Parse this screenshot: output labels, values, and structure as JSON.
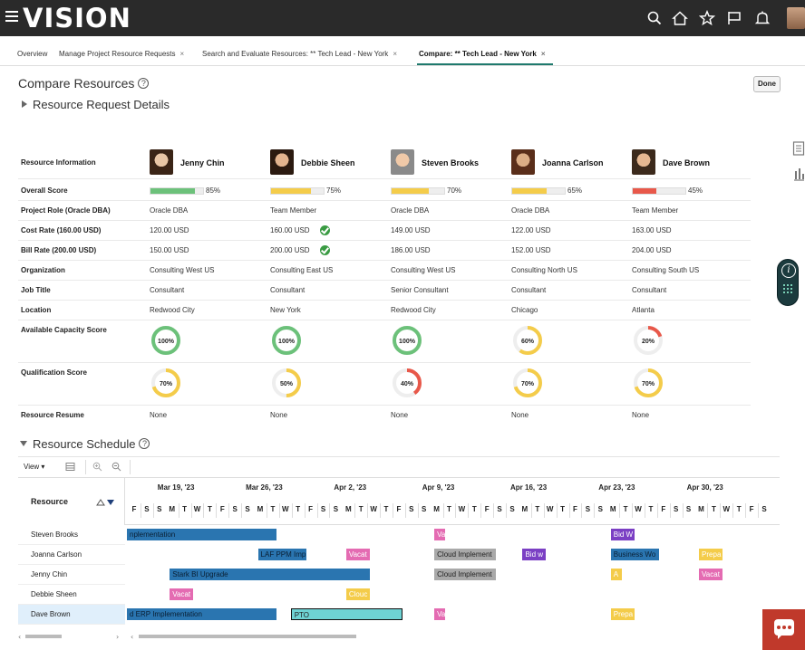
{
  "app": {
    "brand": "VISION"
  },
  "tabs": [
    {
      "label": "Overview",
      "closable": false
    },
    {
      "label": "Manage Project Resource Requests",
      "closable": true
    },
    {
      "label": "Search and Evaluate Resources: ** Tech Lead - New York",
      "closable": true
    },
    {
      "label": "Compare: ** Tech Lead - New York",
      "closable": true,
      "active": true
    }
  ],
  "tab_close_glyph": "×",
  "page": {
    "title": "Compare Resources",
    "done_label": "Done",
    "details_label": "Resource Request Details"
  },
  "compare": {
    "header_label": "Resource Information",
    "row_labels": {
      "overall": "Overall Score",
      "role": "Project Role (Oracle DBA)",
      "cost": "Cost Rate (160.00 USD)",
      "bill": "Bill Rate (200.00 USD)",
      "org": "Organization",
      "job": "Job Title",
      "location": "Location",
      "capacity": "Available Capacity Score",
      "qualification": "Qualification Score",
      "resume": "Resource Resume"
    },
    "people": [
      {
        "name": "Jenny Chin",
        "overall": 85,
        "overall_label": "85%",
        "role": "Oracle DBA",
        "cost": "120.00 USD",
        "cost_ok": false,
        "bill": "150.00 USD",
        "bill_ok": false,
        "org": "Consulting West US",
        "job": "Consultant",
        "location": "Redwood City",
        "capacity": 100,
        "capacity_label": "100%",
        "qualification": 70,
        "qualification_label": "70%",
        "resume": "None"
      },
      {
        "name": "Debbie Sheen",
        "overall": 75,
        "overall_label": "75%",
        "role": "Team Member",
        "cost": "160.00 USD",
        "cost_ok": true,
        "bill": "200.00 USD",
        "bill_ok": true,
        "org": "Consulting East US",
        "job": "Consultant",
        "location": "New York",
        "capacity": 100,
        "capacity_label": "100%",
        "qualification": 50,
        "qualification_label": "50%",
        "resume": "None"
      },
      {
        "name": "Steven Brooks",
        "overall": 70,
        "overall_label": "70%",
        "role": "Oracle DBA",
        "cost": "149.00 USD",
        "cost_ok": false,
        "bill": "186.00 USD",
        "bill_ok": false,
        "org": "Consulting West US",
        "job": "Senior Consultant",
        "location": "Redwood City",
        "capacity": 100,
        "capacity_label": "100%",
        "qualification": 40,
        "qualification_label": "40%",
        "resume": "None"
      },
      {
        "name": "Joanna Carlson",
        "overall": 65,
        "overall_label": "65%",
        "role": "Oracle DBA",
        "cost": "122.00 USD",
        "cost_ok": false,
        "bill": "152.00 USD",
        "bill_ok": false,
        "org": "Consulting North US",
        "job": "Consultant",
        "location": "Chicago",
        "capacity": 60,
        "capacity_label": "60%",
        "qualification": 70,
        "qualification_label": "70%",
        "resume": "None"
      },
      {
        "name": "Dave Brown",
        "overall": 45,
        "overall_label": "45%",
        "role": "Team Member",
        "cost": "163.00 USD",
        "cost_ok": false,
        "bill": "204.00 USD",
        "bill_ok": false,
        "org": "Consulting South US",
        "job": "Consultant",
        "location": "Atlanta",
        "capacity": 20,
        "capacity_label": "20%",
        "qualification": 70,
        "qualification_label": "70%",
        "resume": "None"
      }
    ]
  },
  "colors": {
    "green": "#6cc17a",
    "yellow": "#f4cc4a",
    "red": "#e8584a",
    "track": "#eeeeee",
    "accent": "#1f7a6d"
  },
  "schedule": {
    "title": "Resource Schedule",
    "view_label": "View",
    "resource_header": "Resource",
    "weeks": [
      "Mar 19, '23",
      "Mar 26, '23",
      "Apr 2, '23",
      "Apr 9, '23",
      "Apr 16, '23",
      "Apr 23, '23",
      "Apr 30, '23"
    ],
    "days": [
      "F",
      "S",
      "S",
      "M",
      "T",
      "W",
      "T",
      "F",
      "S",
      "S",
      "M",
      "T",
      "W",
      "T",
      "F",
      "S",
      "S",
      "M",
      "T",
      "W",
      "T",
      "F",
      "S",
      "S",
      "M",
      "T",
      "W",
      "T",
      "F",
      "S",
      "S",
      "M",
      "T",
      "W",
      "T",
      "F",
      "S",
      "S",
      "M",
      "T",
      "W",
      "T",
      "F",
      "S",
      "S",
      "M",
      "T",
      "W",
      "T",
      "F",
      "S"
    ],
    "resources": [
      "Steven Brooks",
      "Joanna Carlson",
      "Jenny Chin",
      "Debbie Sheen",
      "Dave Brown"
    ],
    "selected_resource": "Dave Brown",
    "bars": [
      {
        "row": 0,
        "start": 0,
        "days": 12,
        "color": "blue",
        "label": "nplementation"
      },
      {
        "row": 0,
        "start": 24.4,
        "days": 1,
        "color": "pink",
        "label": "Va"
      },
      {
        "row": 0,
        "start": 38.4,
        "days": 2,
        "color": "purple",
        "label": "Bid W"
      },
      {
        "row": 1,
        "start": 10.4,
        "days": 4,
        "color": "blue",
        "label": "LAF PPM Imp"
      },
      {
        "row": 1,
        "start": 17.4,
        "days": 2,
        "color": "pink",
        "label": "Vacat"
      },
      {
        "row": 1,
        "start": 24.4,
        "days": 5,
        "color": "gray",
        "label": "Cloud Implement"
      },
      {
        "row": 1,
        "start": 31.4,
        "days": 2,
        "color": "purple",
        "label": "Bid w"
      },
      {
        "row": 1,
        "start": 38.4,
        "days": 4,
        "color": "blue",
        "label": "Business Wo"
      },
      {
        "row": 1,
        "start": 45.4,
        "days": 2,
        "color": "yellow",
        "label": "Prepa"
      },
      {
        "row": 2,
        "start": 3.4,
        "days": 16,
        "color": "blue",
        "label": "Stark BI Upgrade"
      },
      {
        "row": 2,
        "start": 24.4,
        "days": 5,
        "color": "gray",
        "label": "Cloud Implement"
      },
      {
        "row": 2,
        "start": 38.4,
        "days": 1,
        "color": "yellow",
        "label": "A"
      },
      {
        "row": 2,
        "start": 45.4,
        "days": 2,
        "color": "pink",
        "label": "Vacat"
      },
      {
        "row": 3,
        "start": 3.4,
        "days": 2,
        "color": "pink",
        "label": "Vacat"
      },
      {
        "row": 3,
        "start": 17.4,
        "days": 2,
        "color": "yellow",
        "label": "Clouc"
      },
      {
        "row": 4,
        "start": 0,
        "days": 12,
        "color": "blue",
        "label": "d ERP Implementation"
      },
      {
        "row": 4,
        "start": 13,
        "days": 9,
        "color": "teal",
        "label": "PTO"
      },
      {
        "row": 4,
        "start": 24.4,
        "days": 1,
        "color": "pink",
        "label": "Va"
      },
      {
        "row": 4,
        "start": 38.4,
        "days": 2,
        "color": "yellow",
        "label": "Prepa"
      }
    ]
  }
}
